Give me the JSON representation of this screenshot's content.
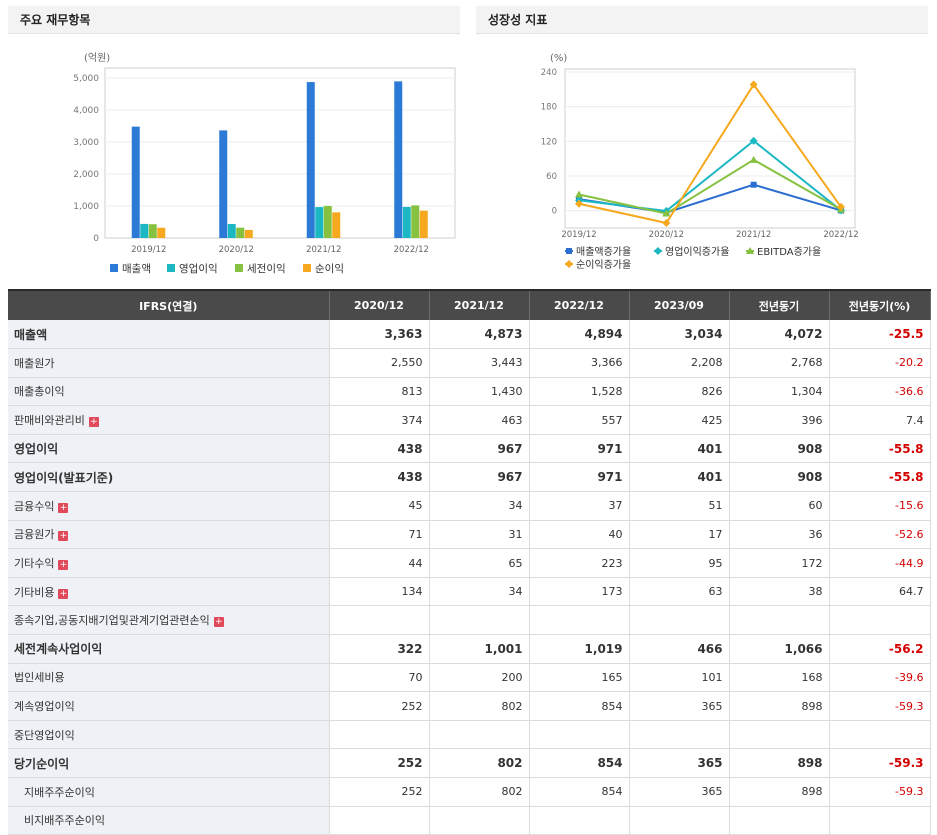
{
  "left_panel": {
    "title": "주요 재무항목"
  },
  "right_panel": {
    "title": "성장성 지표"
  },
  "chart_data": [
    {
      "type": "bar",
      "unit": "(억원)",
      "categories": [
        "2019/12",
        "2020/12",
        "2021/12",
        "2022/12"
      ],
      "yticks": [
        "0",
        "1,000",
        "2,000",
        "3,000",
        "4,000",
        "5,000"
      ],
      "ylim": [
        0,
        5000
      ],
      "series": [
        {
          "name": "매출액",
          "color": "#2a7ad6",
          "values": [
            3480,
            3363,
            4873,
            4894
          ]
        },
        {
          "name": "영업이익",
          "color": "#1bb8c4",
          "values": [
            440,
            438,
            967,
            971
          ]
        },
        {
          "name": "세전이익",
          "color": "#86c240",
          "values": [
            430,
            322,
            1001,
            1019
          ]
        },
        {
          "name": "순이익",
          "color": "#f6a81e",
          "values": [
            320,
            252,
            802,
            854
          ]
        }
      ]
    },
    {
      "type": "line",
      "unit": "(%)",
      "categories": [
        "2019/12",
        "2020/12",
        "2021/12",
        "2022/12"
      ],
      "yticks": [
        "0",
        "60",
        "120",
        "180",
        "240"
      ],
      "ylim": [
        -30,
        240
      ],
      "series": [
        {
          "name": "매출액증가율",
          "color": "#2a6ed0",
          "marker": "square",
          "values": [
            20,
            -3.4,
            44.9,
            0.4
          ]
        },
        {
          "name": "영업이익증가율",
          "color": "#1bb8c4",
          "marker": "diamond",
          "values": [
            18,
            -0.5,
            120.8,
            0.4
          ]
        },
        {
          "name": "EBITDA증가율",
          "color": "#86c240",
          "marker": "triangle",
          "values": [
            28,
            -5,
            88,
            2
          ]
        },
        {
          "name": "순이익증가율",
          "color": "#f6a81e",
          "marker": "diamond",
          "values": [
            12,
            -21.3,
            218.3,
            6.5
          ]
        }
      ]
    }
  ],
  "table": {
    "headers": [
      "IFRS(연결)",
      "2020/12",
      "2021/12",
      "2022/12",
      "2023/09",
      "전년동기",
      "전년동기(%)"
    ],
    "rows": [
      {
        "label": "매출액",
        "bold": true,
        "values": [
          "3,363",
          "4,873",
          "4,894",
          "3,034",
          "4,072",
          "-25.5"
        ]
      },
      {
        "label": "매출원가",
        "values": [
          "2,550",
          "3,443",
          "3,366",
          "2,208",
          "2,768",
          "-20.2"
        ]
      },
      {
        "label": "매출총이익",
        "values": [
          "813",
          "1,430",
          "1,528",
          "826",
          "1,304",
          "-36.6"
        ]
      },
      {
        "label": "판매비와관리비",
        "expand": true,
        "values": [
          "374",
          "463",
          "557",
          "425",
          "396",
          "7.4"
        ]
      },
      {
        "label": "영업이익",
        "bold": true,
        "values": [
          "438",
          "967",
          "971",
          "401",
          "908",
          "-55.8"
        ]
      },
      {
        "label": "영업이익(발표기준)",
        "bold": true,
        "values": [
          "438",
          "967",
          "971",
          "401",
          "908",
          "-55.8"
        ]
      },
      {
        "label": "금융수익",
        "expand": true,
        "values": [
          "45",
          "34",
          "37",
          "51",
          "60",
          "-15.6"
        ]
      },
      {
        "label": "금융원가",
        "expand": true,
        "values": [
          "71",
          "31",
          "40",
          "17",
          "36",
          "-52.6"
        ]
      },
      {
        "label": "기타수익",
        "expand": true,
        "values": [
          "44",
          "65",
          "223",
          "95",
          "172",
          "-44.9"
        ]
      },
      {
        "label": "기타비용",
        "expand": true,
        "values": [
          "134",
          "34",
          "173",
          "63",
          "38",
          "64.7"
        ]
      },
      {
        "label": "종속기업,공동지배기업및관계기업관련손익",
        "expand": true,
        "values": [
          "",
          "",
          "",
          "",
          "",
          ""
        ]
      },
      {
        "label": "세전계속사업이익",
        "bold": true,
        "values": [
          "322",
          "1,001",
          "1,019",
          "466",
          "1,066",
          "-56.2"
        ]
      },
      {
        "label": "법인세비용",
        "values": [
          "70",
          "200",
          "165",
          "101",
          "168",
          "-39.6"
        ]
      },
      {
        "label": "계속영업이익",
        "values": [
          "252",
          "802",
          "854",
          "365",
          "898",
          "-59.3"
        ]
      },
      {
        "label": "중단영업이익",
        "values": [
          "",
          "",
          "",
          "",
          "",
          ""
        ]
      },
      {
        "label": "당기순이익",
        "bold": true,
        "values": [
          "252",
          "802",
          "854",
          "365",
          "898",
          "-59.3"
        ]
      },
      {
        "label": "지배주주순이익",
        "sub": true,
        "values": [
          "252",
          "802",
          "854",
          "365",
          "898",
          "-59.3"
        ]
      },
      {
        "label": "비지배주주순이익",
        "sub": true,
        "values": [
          "",
          "",
          "",
          "",
          "",
          ""
        ]
      }
    ]
  }
}
